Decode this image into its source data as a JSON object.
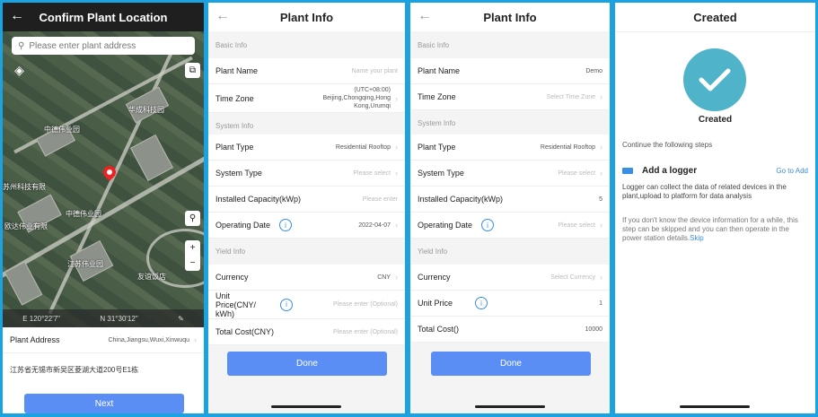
{
  "panel1": {
    "title": "Confirm Plant Location",
    "search_placeholder": "Please enter plant address",
    "map_labels": [
      "中德伟业园",
      "华成科技园",
      "苏州科技有限",
      "中德伟业园",
      "欧达伟业有限",
      "江苏伟业园",
      "友谊饭店"
    ],
    "coord_e": "E 120°22'7\"",
    "coord_n": "N 31°30'12\"",
    "address_label": "Plant Address",
    "address_value": "China,Jiangsu,Wuxi,Xinwuqu",
    "address_detail": "江苏省无锡市新吴区菱湖大道200号E1栋",
    "next_button": "Next"
  },
  "panel2": {
    "title": "Plant Info",
    "sec_basic": "Basic Info",
    "plant_name_label": "Plant Name",
    "plant_name_placeholder": "Name your plant",
    "timezone_label": "Time Zone",
    "timezone_value": "(UTC+08:00) Beijing,Chongqing,Hong Kong,Urumqi",
    "sec_system": "System Info",
    "plant_type_label": "Plant Type",
    "plant_type_value": "Residential Rooftop",
    "system_type_label": "System Type",
    "system_type_placeholder": "Please select",
    "capacity_label": "Installed Capacity(kWp)",
    "capacity_placeholder": "Please enter",
    "op_date_label": "Operating Date",
    "op_date_value": "2022-04-07",
    "sec_yield": "Yield Info",
    "currency_label": "Currency",
    "currency_value": "CNY",
    "unit_price_label": "Unit Price(CNY/ kWh)",
    "unit_price_placeholder": "Please enter (Optional)",
    "total_cost_label": "Total Cost(CNY)",
    "total_cost_placeholder": "Please enter (Optional)",
    "done_button": "Done"
  },
  "panel3": {
    "title": "Plant Info",
    "sec_basic": "Basic Info",
    "plant_name_label": "Plant Name",
    "plant_name_value": "Demo",
    "timezone_label": "Time Zone",
    "timezone_placeholder": "Select Time Zone",
    "sec_system": "System Info",
    "plant_type_label": "Plant Type",
    "plant_type_value": "Residential Rooftop",
    "system_type_label": "System Type",
    "system_type_placeholder": "Please select",
    "capacity_label": "Installed Capacity(kWp)",
    "capacity_value": "5",
    "op_date_label": "Operating Date",
    "op_date_placeholder": "Please select",
    "sec_yield": "Yield Info",
    "currency_label": "Currency",
    "currency_placeholder": "Select Currency",
    "unit_price_label": "Unit Price",
    "unit_price_value": "1",
    "total_cost_label": "Total Cost()",
    "total_cost_value": "10000",
    "done_button": "Done"
  },
  "panel4": {
    "title": "Created",
    "created_label": "Created",
    "continue_text": "Continue the following steps",
    "add_logger_title": "Add a logger",
    "go_to_add": "Go to Add",
    "logger_desc": "Logger can collect the data of related devices in the plant,upload to platform for data analysis",
    "skip_desc": "If you don't know the device information for a while, this step can be skipped and you can then operate in the power station details.",
    "skip_link": "Skip"
  },
  "colors": {
    "accent": "#5b8ef5",
    "check_circle": "#4fb3c9",
    "frame": "#1aa3e0",
    "pin": "#e22222"
  },
  "icons": [
    "back-arrow-icon",
    "search-icon",
    "layers-icon",
    "expand-icon",
    "location-icon",
    "zoom-in-icon",
    "zoom-out-icon",
    "map-pin-icon",
    "chevron-right-icon",
    "info-icon",
    "checkmark-icon",
    "logger-icon"
  ]
}
